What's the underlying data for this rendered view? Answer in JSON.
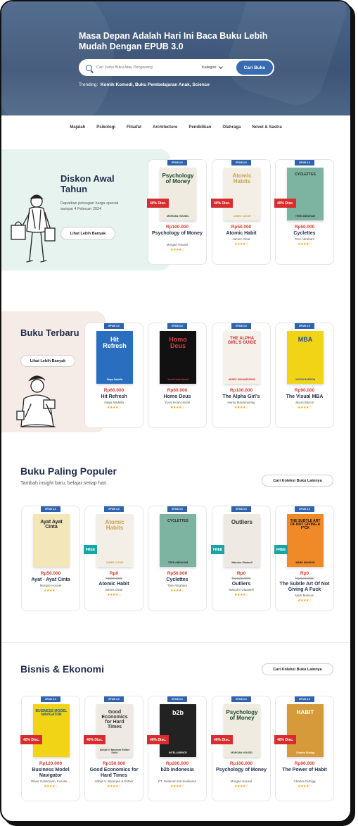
{
  "hero": {
    "title": "Masa Depan Adalah Hari Ini Baca Buku Lebih Mudah Dengan EPUB 3.0",
    "search_placeholder": "Cari Judul Buku Atau Pengarang",
    "category_label": "Kategori",
    "search_button": "Cari Buku",
    "trending_label": "Trending:",
    "trending_items": "Komik Komedi, Buku Pembelajaran Anak, Science"
  },
  "nav": [
    "Majalah",
    "Psikologi",
    "Filsafat",
    "Architecture",
    "Pendidikan",
    "Olahraga",
    "Novel & Sastra"
  ],
  "epub_tag": "EPUB 3.0",
  "discount_section": {
    "title": "Diskon Awal Tahun",
    "subtitle": "Dapatkan potongan harga special sampai 4 Februari 2024",
    "button": "Lihat Lebih Banyak",
    "books": [
      {
        "title": "Psychology of Money",
        "author": "Morgan Housel",
        "price": "Rp100.000",
        "badge": "40% Disc.",
        "cover_text": "Psychology of Money",
        "cover_author": "MORGAN HOUSEL"
      },
      {
        "title": "Atomic Habit",
        "author": "James Clear",
        "price": "Rp50.000",
        "badge": "40% Disc.",
        "cover_text": "Atomic Habits",
        "cover_author": "JAMES CLEAR"
      },
      {
        "title": "Cyclettes",
        "author": "Tree Abraham",
        "price": "Rp50.000",
        "badge": "40% Disc.",
        "cover_text": "CYCLETTES",
        "cover_author": "TREE ABRAHAM"
      }
    ]
  },
  "new_section": {
    "title": "Buku Terbaru",
    "button": "Lihat Lebih Banyak",
    "books": [
      {
        "title": "Hit Refresh",
        "author": "Satya Nadella",
        "price": "Rp60.000",
        "cover_text": "Hit Refresh",
        "cover_author": "Satya Nadella"
      },
      {
        "title": "Homo Deus",
        "author": "Yuval Noah Harari",
        "price": "Rp60.000",
        "cover_text": "Homo Deus",
        "cover_author": "Yuval Noah Harari"
      },
      {
        "title": "The Alpha Girl's",
        "author": "Henry Manampiring",
        "price": "Rp100.000",
        "cover_text": "THE ALPHA GIRL'S GUIDE",
        "cover_author": "HENRY MANAMPIRING"
      },
      {
        "title": "The Visual MBA",
        "author": "Jason Barron",
        "price": "Rp90.000",
        "cover_text": "MBA",
        "cover_author": "JASON BARRON"
      }
    ]
  },
  "popular_section": {
    "title": "Buku Paling Populer",
    "subtitle": "Tambah insight baru, belajar setiap hari.",
    "button": "Cari Koleksi Buku Lainnya",
    "books": [
      {
        "title": "Ayat - Ayat Cinta",
        "author": "Morgan Housel",
        "price": "Rp50.000",
        "old_price": "",
        "badge": "",
        "cover_text": "Ayat Ayat Cinta",
        "cover_author": ""
      },
      {
        "title": "Atomic Habit",
        "author": "James Clear",
        "price": "Rp0",
        "old_price": "Rp50.000",
        "badge": "FREE",
        "cover_text": "Atomic Habits",
        "cover_author": "JAMES CLEAR"
      },
      {
        "title": "Cyclettes",
        "author": "Tree Abraham",
        "price": "Rp50.000",
        "old_price": "",
        "badge": "",
        "cover_text": "CYCLETTES",
        "cover_author": "TREE ABRAHAM"
      },
      {
        "title": "Outliers",
        "author": "Malcolm Gladwell",
        "price": "Rp0",
        "old_price": "Rp120.000",
        "badge": "FREE",
        "cover_text": "Outliers",
        "cover_author": "Malcolm Gladwell"
      },
      {
        "title": "The Subtle Art Of Not Giving A Fuck",
        "author": "Mark Manson",
        "price": "Rp0",
        "old_price": "Rp120.000",
        "badge": "FREE",
        "cover_text": "THE SUBTLE ART OF NOT GIVING A F*CK",
        "cover_author": "MARK MANSON"
      }
    ]
  },
  "business_section": {
    "title": "Bisnis & Ekonomi",
    "button": "Cari Koleksi Buku Lainnya",
    "books": [
      {
        "title": "Business Model Navigator",
        "author": "Oliver Gassmann, Karolin,...",
        "price": "Rp120.000",
        "badge": "40% Disc.",
        "cover_text": "BUSINESS MODEL NAVIGATOR",
        "cover_author": ""
      },
      {
        "title": "Good Economics for Hard Times",
        "author": "Abhijit V. Banerjee & Esther",
        "price": "Rp150.000",
        "badge": "40% Disc.",
        "cover_text": "Good Economics for Hard Times",
        "cover_author": "Abhijit V. Banerjee Esther Duflo"
      },
      {
        "title": "b2b Indonesia",
        "author": "PT. Dutaindo Inti Swakarsa",
        "price": "Rp200.000",
        "badge": "40% Disc.",
        "cover_text": "b2b",
        "cover_author": "INTELLIGENCE"
      },
      {
        "title": "Psychology of Money",
        "author": "Morgan Housel",
        "price": "Rp100.000",
        "badge": "40% Disc.",
        "cover_text": "Psychology of Money",
        "cover_author": "MORGAN HOUSEL"
      },
      {
        "title": "The Power of Habit",
        "author": "Charles Duhigg",
        "price": "Rp90.000",
        "badge": "40% Disc.",
        "cover_text": "HABIT",
        "cover_author": "Charles Duhigg"
      }
    ]
  },
  "rating_stars": "★★★★☆",
  "colors": {
    "primary": "#2f64ad",
    "discount": "#d72d2d",
    "free": "#17a6a6",
    "price": "#d8392b",
    "star": "#e9a20f"
  }
}
